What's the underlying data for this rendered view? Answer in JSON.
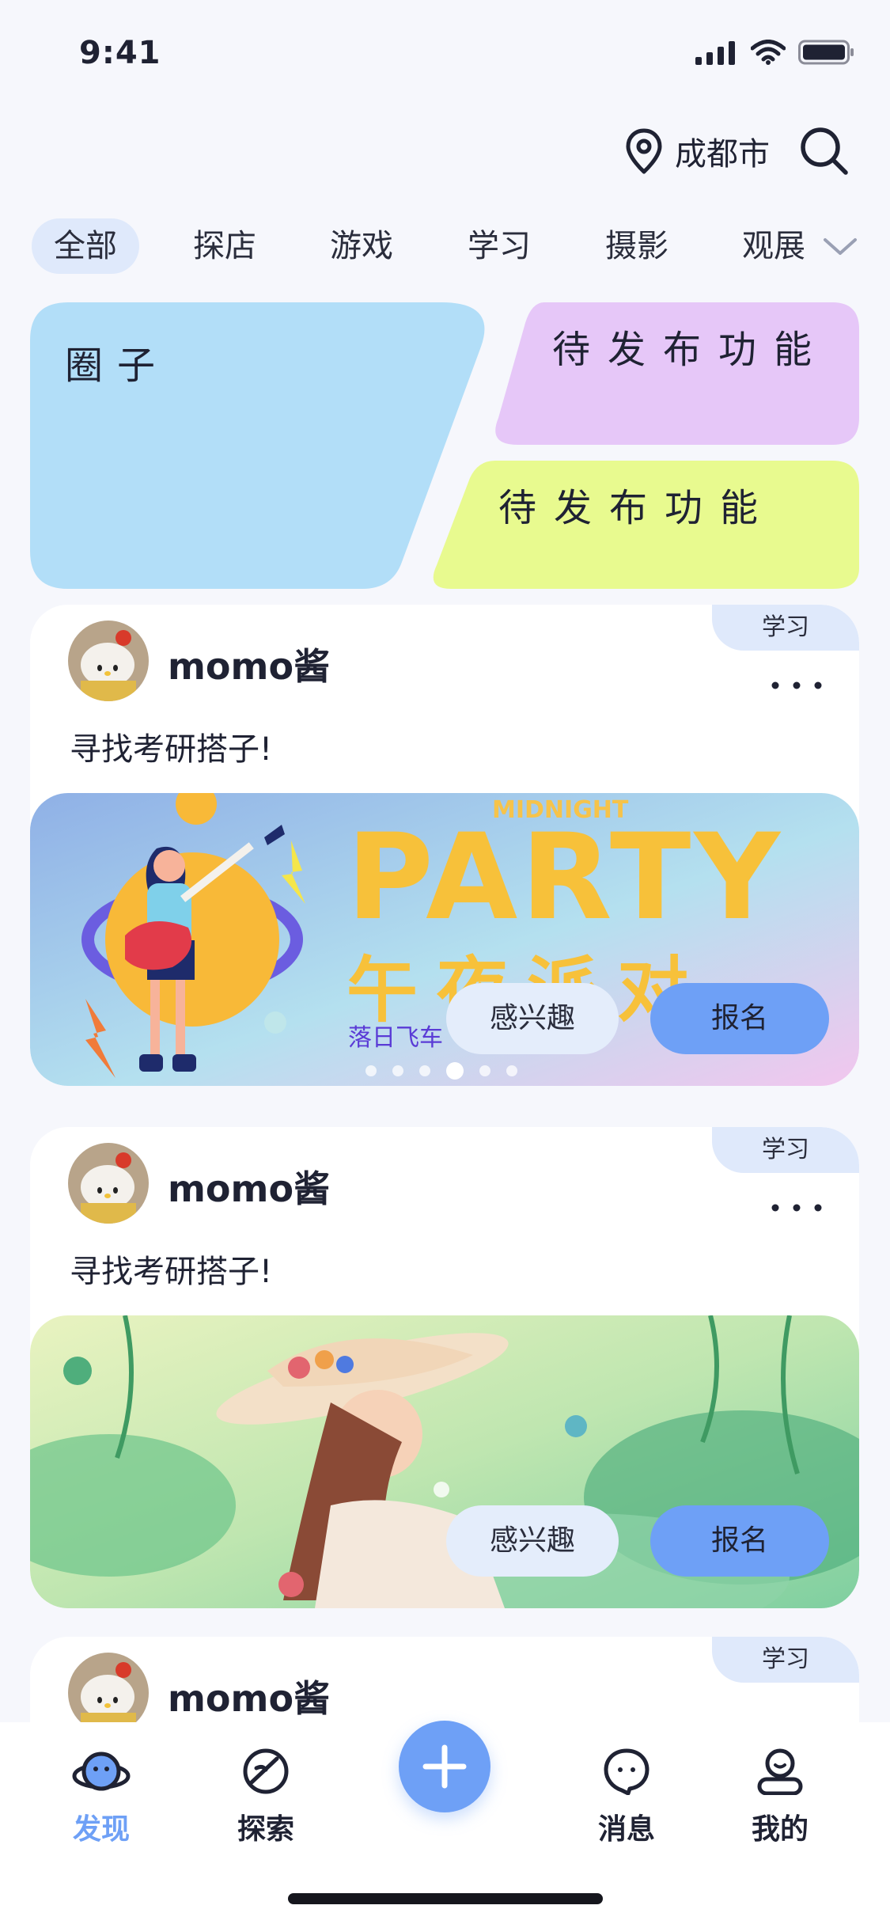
{
  "status_bar": {
    "time": "9:41"
  },
  "header": {
    "city": "成都市"
  },
  "tabs": [
    {
      "label": "全部",
      "active": true
    },
    {
      "label": "探店"
    },
    {
      "label": "游戏"
    },
    {
      "label": "学习"
    },
    {
      "label": "摄影"
    },
    {
      "label": "观展"
    }
  ],
  "feature_cards": {
    "circle": "圈子",
    "pending_1": "待发布功能",
    "pending_2": "待发布功能"
  },
  "posts": [
    {
      "tag": "学习",
      "username": "momo酱",
      "text": "寻找考研搭子!",
      "interest_label": "感兴趣",
      "signup_label": "报名",
      "banner": {
        "subtitle": "MIDNIGHT",
        "title": "PARTY",
        "title_cn": "午夜派对",
        "caption": "落日飞车",
        "slides": 6,
        "active_slide": 4
      }
    },
    {
      "tag": "学习",
      "username": "momo酱",
      "text": "寻找考研搭子!",
      "interest_label": "感兴趣",
      "signup_label": "报名"
    },
    {
      "tag": "学习",
      "username": "momo酱"
    }
  ],
  "tabbar": [
    {
      "label": "发现",
      "icon": "planet-icon",
      "active": true
    },
    {
      "label": "探索",
      "icon": "compass-icon"
    },
    {
      "label": "",
      "icon": "plus-icon"
    },
    {
      "label": "消息",
      "icon": "chat-bubble-icon"
    },
    {
      "label": "我的",
      "icon": "user-icon"
    }
  ],
  "colors": {
    "accent": "#6ea0f6",
    "tag_bg": "#dfe9fb",
    "circle_card": "#b2def8",
    "pending_purple": "#e6c7f8",
    "pending_lime": "#e8fa8f"
  }
}
